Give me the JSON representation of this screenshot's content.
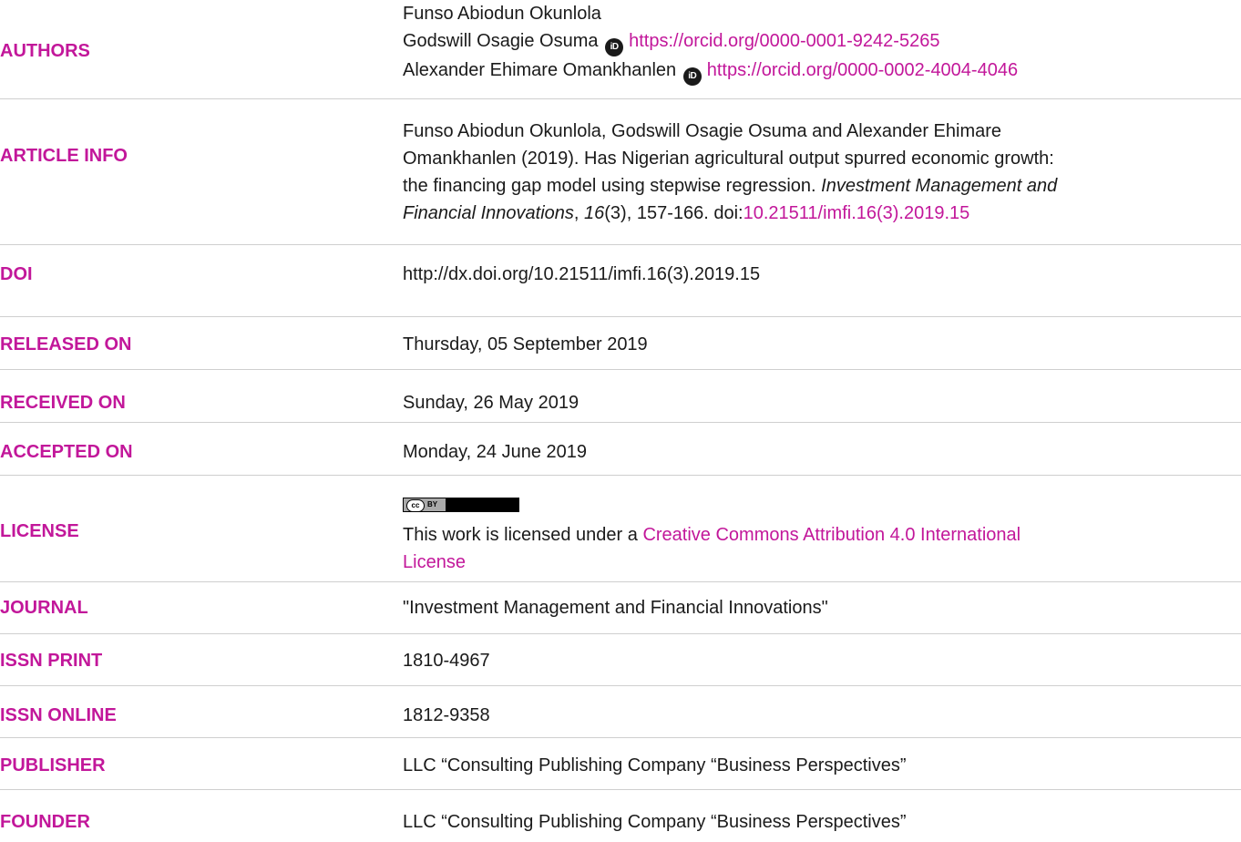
{
  "rows": {
    "authors": {
      "label": "AUTHORS",
      "names": [
        "Funso Abiodun Okunlola",
        "Godswill Osagie Osuma",
        "Alexander Ehimare Omankhanlen"
      ],
      "orcid_1": "https://orcid.org/0000-0001-9242-5265",
      "orcid_2": "https://orcid.org/0000-0002-4004-4046",
      "orcid_icon": "orcid-id-icon"
    },
    "article_info": {
      "label": "ARTICLE INFO",
      "citation_part1": "Funso Abiodun Okunlola, Godswill Osagie Osuma and Alexander Ehimare",
      "citation_part2": "Omankhanlen (2019). Has Nigerian agricultural output spurred economic growth:",
      "citation_part3a": "the financing gap model using stepwise regression. ",
      "citation_journal_a": "Investment Management and",
      "citation_journal_b": "Financial Innovations",
      "citation_sep": ", ",
      "citation_volume": "16",
      "citation_pages": "(3), 157-166. doi:",
      "citation_doi": "10.21511/imfi.16(3).2019.15"
    },
    "doi": {
      "label": "DOI",
      "value": "http://dx.doi.org/10.21511/imfi.16(3).2019.15"
    },
    "released_on": {
      "label": "RELEASED ON",
      "value": "Thursday, 05 September 2019"
    },
    "received_on": {
      "label": "RECEIVED ON",
      "value": "Sunday, 26 May 2019"
    },
    "accepted_on": {
      "label": "ACCEPTED ON",
      "value": "Monday, 24 June 2019"
    },
    "license": {
      "label": "LICENSE",
      "badge_cc": "cc",
      "badge_by": "BY",
      "text_prefix": "This work is licensed under a ",
      "link_line1": "Creative Commons Attribution 4.0 International",
      "link_line2": "License"
    },
    "journal": {
      "label": "JOURNAL",
      "value": "\"Investment Management and Financial Innovations\""
    },
    "issn_print": {
      "label": "ISSN PRINT",
      "value": "1810-4967"
    },
    "issn_online": {
      "label": "ISSN ONLINE",
      "value": "1812-9358"
    },
    "publisher": {
      "label": "PUBLISHER",
      "value": "LLC “Consulting Publishing Company “Business Perspectives”"
    },
    "founder": {
      "label": "FOUNDER",
      "value": "LLC “Consulting Publishing Company “Business Perspectives”"
    }
  },
  "colors": {
    "label_accent": "#c2179a",
    "link": "#c2179a",
    "text": "#1a1a1a",
    "divider": "#cfcfcf"
  }
}
